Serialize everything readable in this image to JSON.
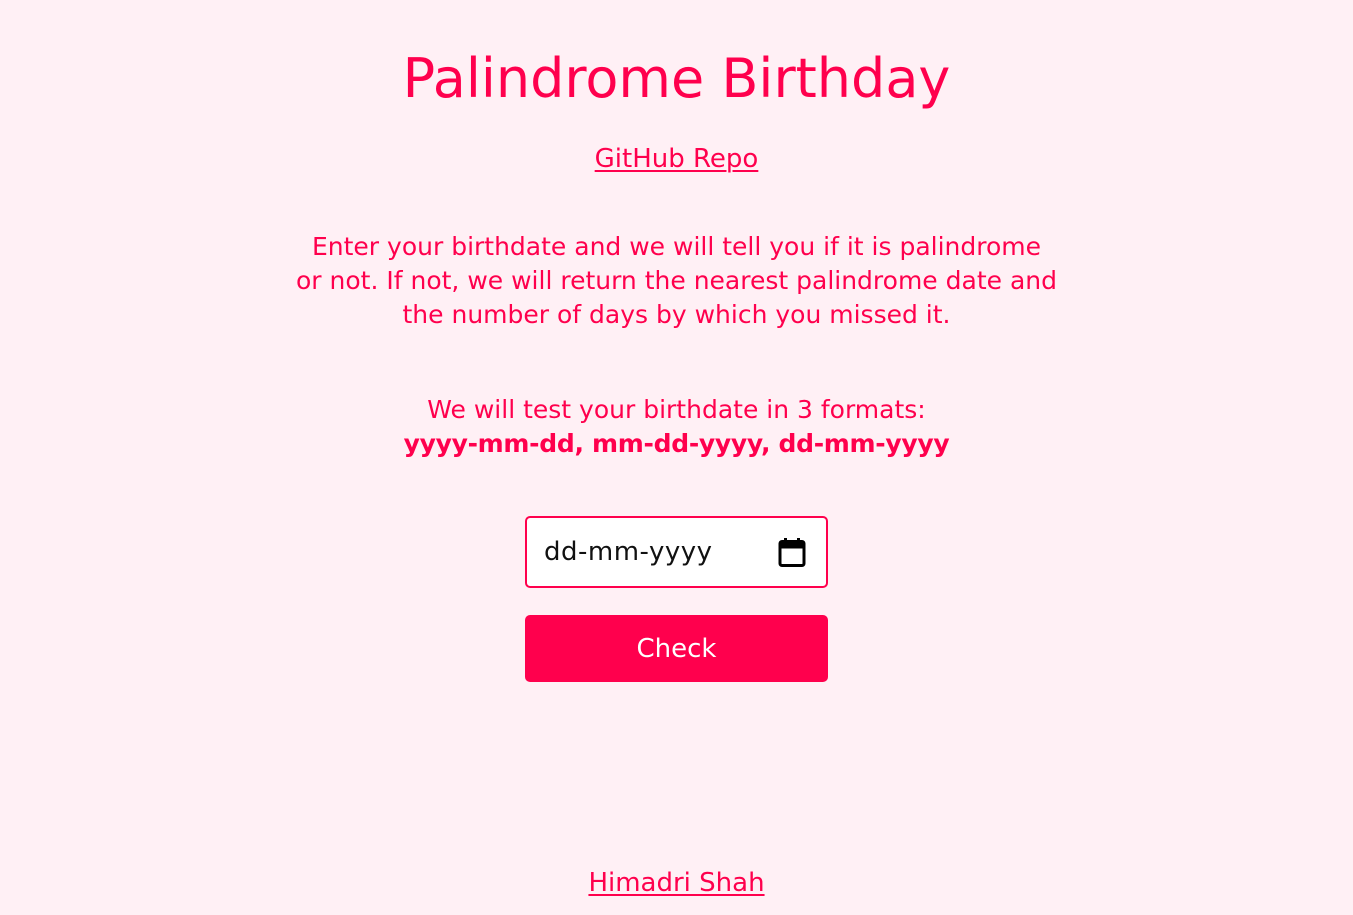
{
  "header": {
    "title": "Palindrome Birthday",
    "repo_link_label": "GitHub Repo"
  },
  "main": {
    "description": "Enter your birthdate and we will tell you if it is palindrome or not. If not, we will return the nearest palindrome date and the number of days by which you missed it.",
    "formats_intro": "We will test your birthdate in 3 formats:",
    "formats_list": "yyyy-mm-dd, mm-dd-yyyy, dd-mm-yyyy",
    "date_input": {
      "placeholder": "dd-mm-yyyy",
      "icon": "calendar-icon"
    },
    "check_button_label": "Check"
  },
  "footer": {
    "author_link_label": "Himadri Shah"
  },
  "colors": {
    "accent": "#ff004d",
    "background": "#fff0f5",
    "button_text": "#ffffff"
  }
}
